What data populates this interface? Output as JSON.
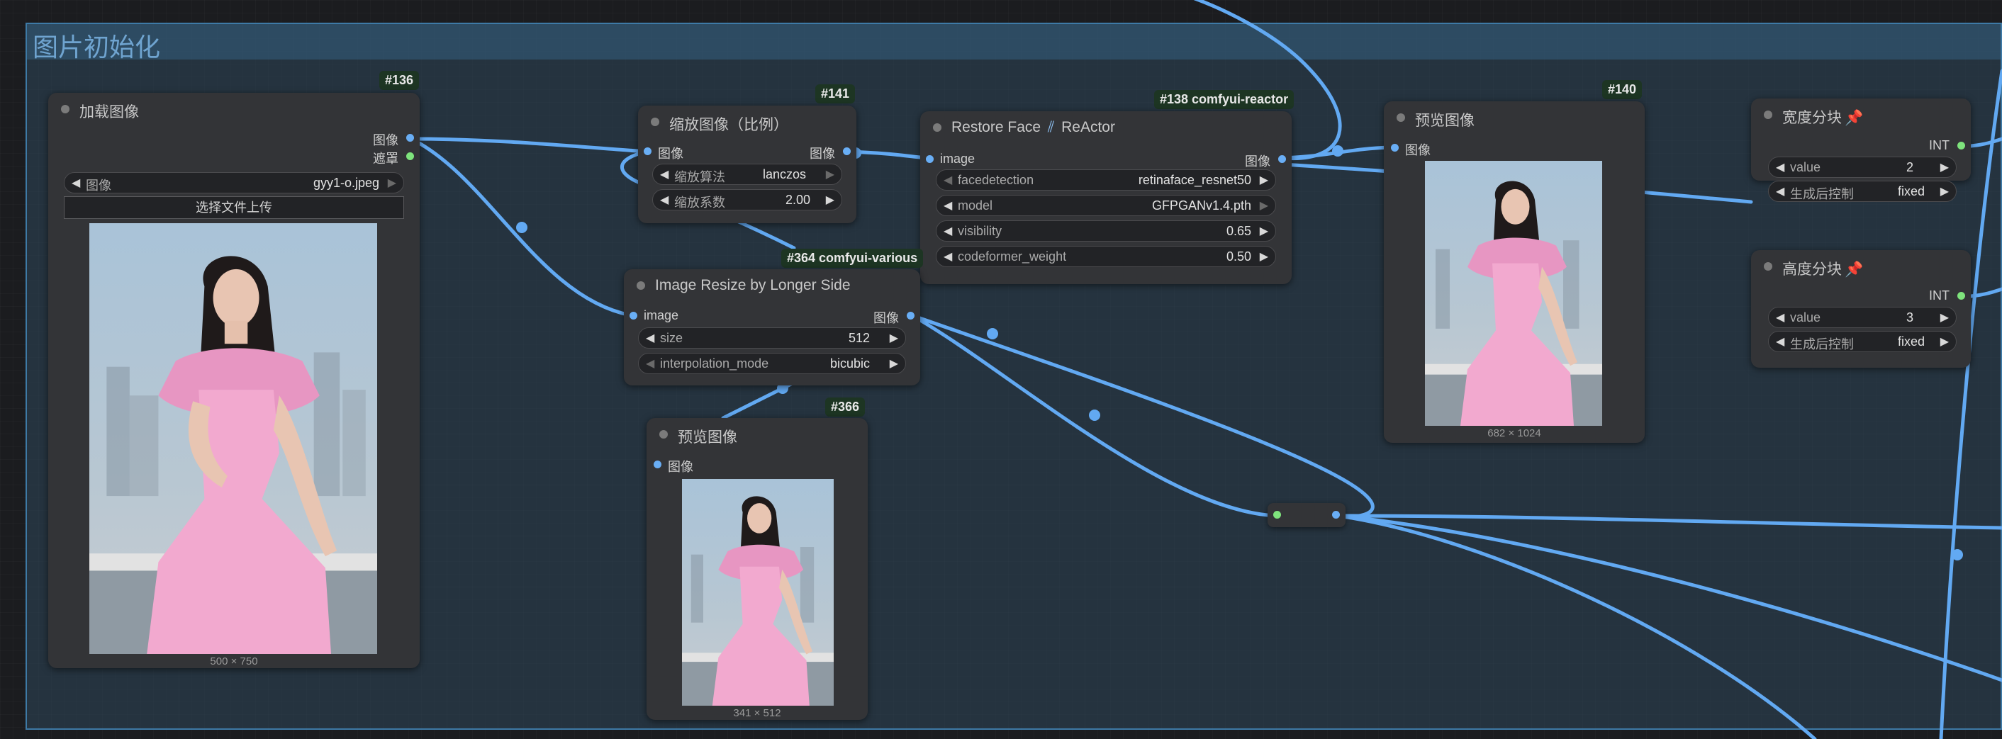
{
  "group": {
    "title": "图片初始化"
  },
  "colors": {
    "wire": "#62a9f2",
    "group_border": "#3e7aa6",
    "node_bg": "#333437",
    "badge_bg": "#1d3523"
  },
  "nodes": {
    "load_image": {
      "badge": "#136",
      "title": "加载图像",
      "outputs": [
        "图像",
        "遮罩"
      ],
      "widget": {
        "label": "图像",
        "value": "gyy1-o.jpeg"
      },
      "upload_button": "选择文件上传",
      "caption": "500 × 750"
    },
    "scale_image": {
      "badge": "#141",
      "title": "缩放图像（比例）",
      "input": "图像",
      "output": "图像",
      "widgets": [
        {
          "label": "缩放算法",
          "value": "lanczos"
        },
        {
          "label": "缩放系数",
          "value": "2.00"
        }
      ]
    },
    "restore_face": {
      "badge": "#138 comfyui-reactor",
      "title": "Restore Face",
      "title_suffix": "ReActor",
      "input": "image",
      "output": "图像",
      "widgets": [
        {
          "label": "facedetection",
          "value": "retinaface_resnet50"
        },
        {
          "label": "model",
          "value": "GFPGANv1.4.pth"
        },
        {
          "label": "visibility",
          "value": "0.65"
        },
        {
          "label": "codeformer_weight",
          "value": "0.50"
        }
      ]
    },
    "resize_longer": {
      "badge": "#364 comfyui-various",
      "title": "Image Resize by Longer Side",
      "input": "image",
      "output": "图像",
      "widgets": [
        {
          "label": "size",
          "value": "512"
        },
        {
          "label": "interpolation_mode",
          "value": "bicubic"
        }
      ]
    },
    "preview_366": {
      "badge": "#366",
      "title": "预览图像",
      "input": "图像",
      "caption": "341 × 512"
    },
    "preview_140": {
      "badge": "#140",
      "title": "预览图像",
      "input": "图像",
      "caption": "682 × 1024"
    },
    "width_split": {
      "title": "宽度分块",
      "output": "INT",
      "widgets": [
        {
          "label": "value",
          "value": "2"
        },
        {
          "label": "生成后控制",
          "value": "fixed"
        }
      ]
    },
    "height_split": {
      "title": "高度分块",
      "output": "INT",
      "widgets": [
        {
          "label": "value",
          "value": "3"
        },
        {
          "label": "生成后控制",
          "value": "fixed"
        }
      ]
    }
  }
}
